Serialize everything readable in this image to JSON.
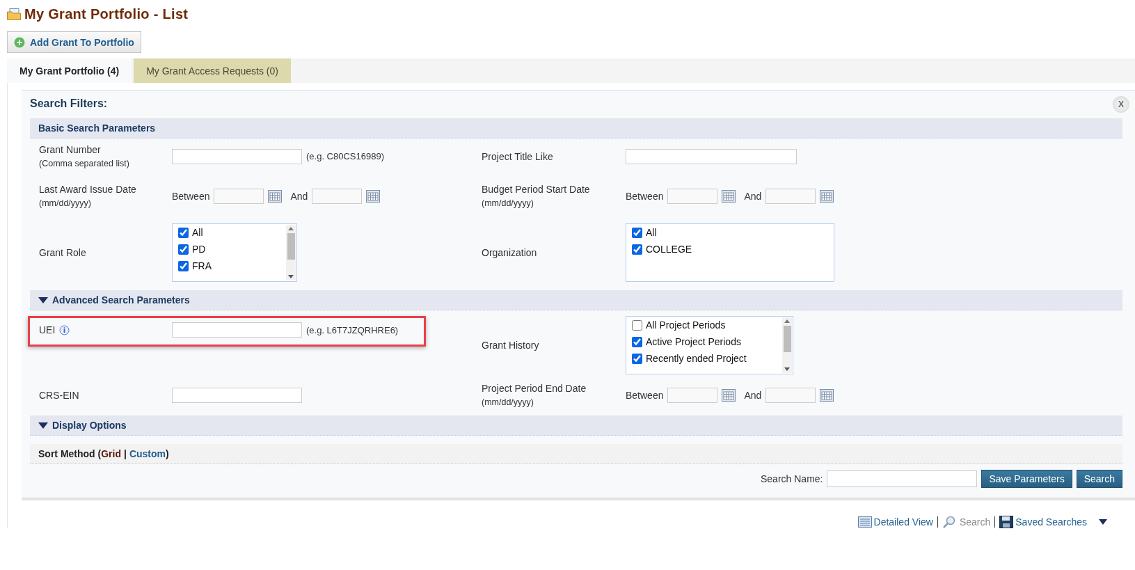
{
  "page_title": "My Grant Portfolio - List",
  "add_button": "Add Grant To Portfolio",
  "tabs": [
    {
      "label": "My Grant Portfolio (4)",
      "selected": true
    },
    {
      "label": "My Grant Access Requests (0)",
      "selected": false
    }
  ],
  "search_filters": {
    "title": "Search Filters:",
    "close": "X",
    "sections": [
      {
        "title": "Basic Search Parameters",
        "kind": "plain",
        "fields": [
          {
            "kind": "text",
            "label": "Grant Number",
            "sublabel": "(Comma separated list)",
            "hint": "(e.g. C80CS16989)"
          },
          {
            "kind": "text",
            "label": "Project Title Like",
            "wide": true
          },
          {
            "kind": "date_range",
            "label": "Last Award Issue Date",
            "sublabel": "(mm/dd/yyyy)",
            "between": "Between",
            "and": "And"
          },
          {
            "kind": "date_range",
            "label": "Budget Period Start Date",
            "sublabel": "(mm/dd/yyyy)",
            "between": "Between",
            "and": "And"
          },
          {
            "kind": "checklist",
            "label": "Grant Role",
            "scrollable": true,
            "options": [
              {
                "label": "All",
                "checked": true
              },
              {
                "label": "PD",
                "checked": true
              },
              {
                "label": "FRA",
                "checked": true
              }
            ]
          },
          {
            "kind": "checklist",
            "label": "Organization",
            "scrollable": false,
            "options": [
              {
                "label": "All",
                "checked": true
              },
              {
                "label": "COLLEGE",
                "checked": true
              }
            ]
          }
        ]
      },
      {
        "title": "Advanced Search Parameters",
        "kind": "collapsible",
        "expanded": true,
        "fields": [
          {
            "kind": "text",
            "label": "UEI",
            "info": true,
            "highlighted": true,
            "hint": "(e.g. L6T7JZQRHRE6)"
          },
          {
            "kind": "checklist",
            "label": "Grant History",
            "scrollable": true,
            "options": [
              {
                "label": "All Project Periods",
                "checked": false
              },
              {
                "label": "Active Project Periods",
                "checked": true
              },
              {
                "label": "Recently ended Project",
                "checked": true
              }
            ]
          },
          {
            "kind": "text",
            "label": "CRS-EIN"
          },
          {
            "kind": "date_range",
            "label": "Project Period End Date",
            "sublabel": "(mm/dd/yyyy)",
            "between": "Between",
            "and": "And"
          }
        ]
      },
      {
        "title": "Display Options",
        "kind": "collapsible",
        "expanded": true
      }
    ],
    "sort": {
      "prefix": "Sort Method (",
      "separator": "|",
      "suffix": ")",
      "options": [
        {
          "label": "Grid",
          "selected": true
        },
        {
          "label": "Custom",
          "selected": false
        }
      ]
    },
    "search_name_label": "Search Name:",
    "buttons": [
      "Save Parameters",
      "Search"
    ]
  },
  "bottom_links": [
    {
      "kind": "detailed",
      "label": "Detailed View",
      "disabled": false
    },
    {
      "kind": "search",
      "label": "Search",
      "disabled": true
    },
    {
      "kind": "saved",
      "label": "Saved Searches",
      "disabled": false
    }
  ]
}
